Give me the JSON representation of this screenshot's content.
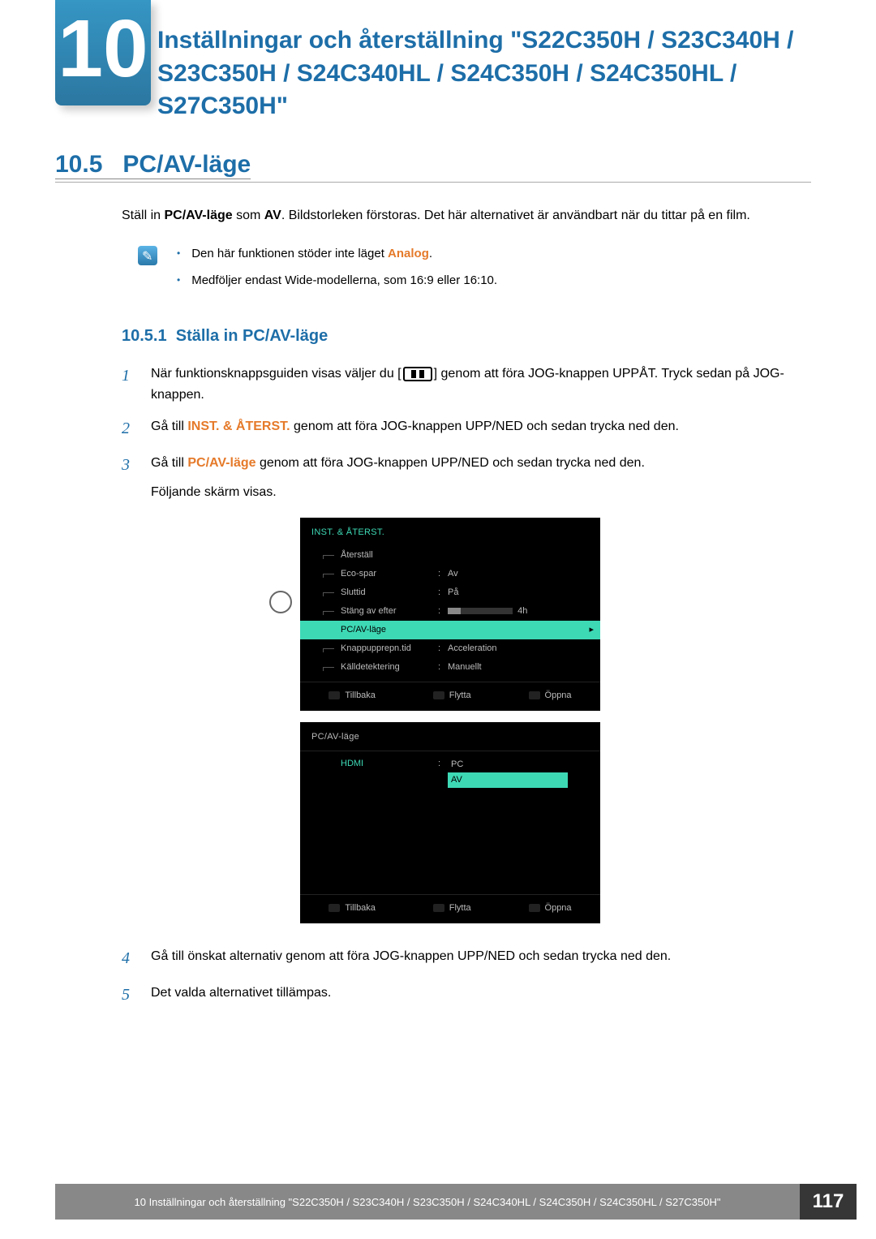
{
  "chapter": {
    "number": "10",
    "title": "Inställningar och återställning \"S22C350H / S23C340H / S23C350H / S24C340HL / S24C350H / S24C350HL / S27C350H\""
  },
  "section": {
    "number": "10.5",
    "title": "PC/AV-läge"
  },
  "intro": {
    "pre": "Ställ in ",
    "term1": "PC/AV-läge",
    "mid1": " som ",
    "term2": "AV",
    "post": ". Bildstorleken förstoras. Det här alternativet är användbart när du tittar på en film."
  },
  "notes": [
    {
      "pre": "Den här funktionen stöder inte läget ",
      "orange": "Analog",
      "post": "."
    },
    {
      "text": "Medföljer endast Wide-modellerna, som 16:9 eller 16:10."
    }
  ],
  "subsection": {
    "number": "10.5.1",
    "title": "Ställa in PC/AV-läge"
  },
  "steps": [
    {
      "n": "1",
      "pre": "När funktionsknappsguiden visas väljer du [",
      "post": "] genom att föra JOG-knappen UPPÅT. Tryck sedan på JOG-knappen."
    },
    {
      "n": "2",
      "pre": "Gå till ",
      "orange": "INST. & ÅTERST.",
      "post": " genom att föra JOG-knappen UPP/NED och sedan trycka ned den."
    },
    {
      "n": "3",
      "pre": "Gå till ",
      "orange": "PC/AV-läge",
      "post": " genom att föra JOG-knappen UPP/NED och sedan trycka ned den.",
      "post2": "Följande skärm visas."
    },
    {
      "n": "4",
      "text": "Gå till önskat alternativ genom att föra JOG-knappen UPP/NED och sedan trycka ned den."
    },
    {
      "n": "5",
      "text": "Det valda alternativet tillämpas."
    }
  ],
  "osd1": {
    "title": "INST. & ÅTERST.",
    "rows": [
      {
        "label": "Återställ",
        "value": ""
      },
      {
        "label": "Eco-spar",
        "value": "Av"
      },
      {
        "label": "Sluttid",
        "value": "På"
      },
      {
        "label": "Stäng av efter",
        "value_bar_suffix": "4h"
      },
      {
        "label": "PC/AV-läge",
        "value": "",
        "highlight": true
      },
      {
        "label": "Knappupprepn.tid",
        "value": "Acceleration"
      },
      {
        "label": "Källdetektering",
        "value": "Manuellt"
      }
    ],
    "nav": {
      "back": "Tillbaka",
      "move": "Flytta",
      "open": "Öppna"
    }
  },
  "osd2": {
    "title": "PC/AV-läge",
    "label": "HDMI",
    "options": [
      "PC",
      "AV"
    ],
    "selected": 1,
    "nav": {
      "back": "Tillbaka",
      "move": "Flytta",
      "open": "Öppna"
    }
  },
  "footer": {
    "text": "10 Inställningar och återställning \"S22C350H / S23C340H / S23C350H / S24C340HL / S24C350H / S24C350HL / S27C350H\"",
    "page": "117"
  }
}
